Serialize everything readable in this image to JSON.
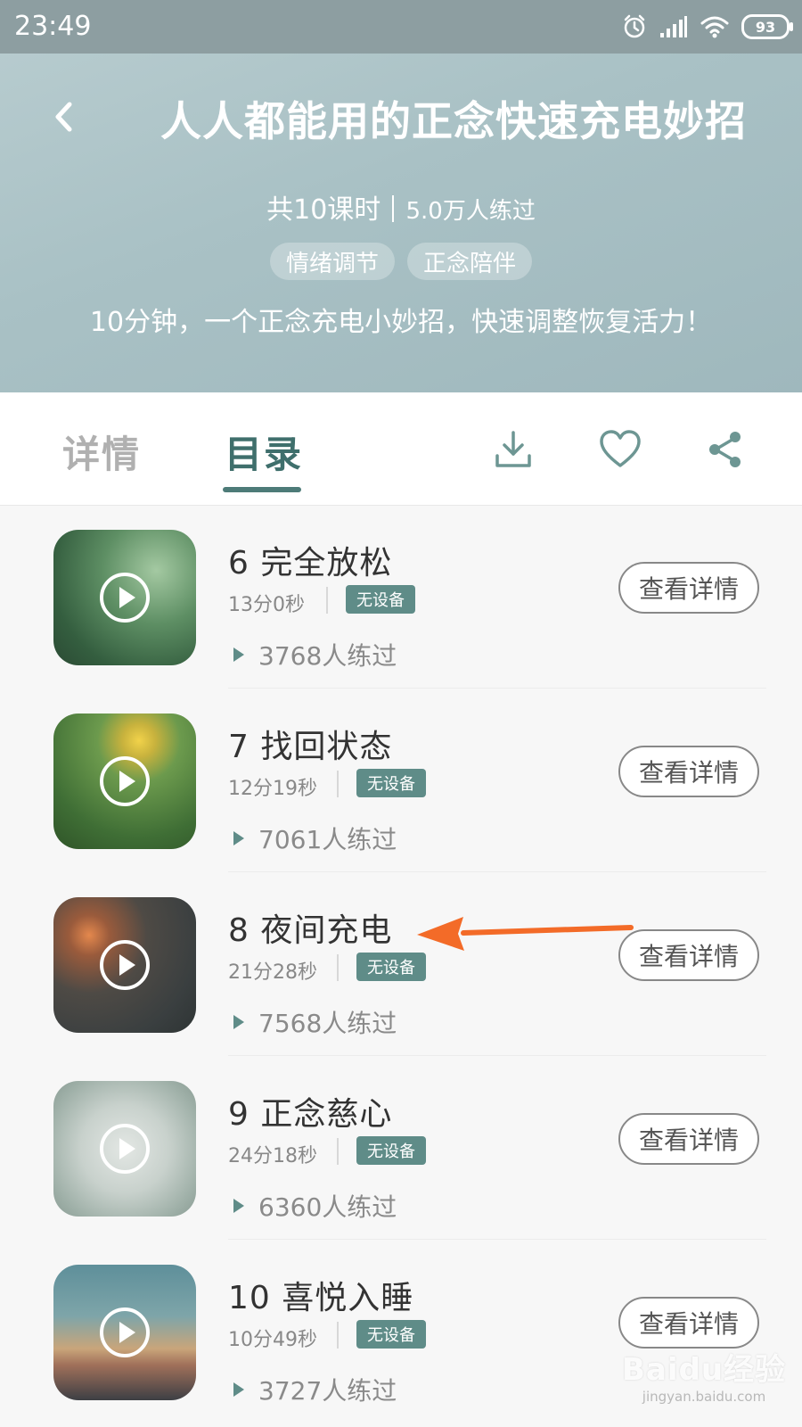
{
  "status_bar": {
    "time": "23:49",
    "battery": "93"
  },
  "header": {
    "title": "人人都能用的正念快速充电妙招",
    "lessons": "共10课时",
    "practiced": "5.0万人练过",
    "tags": [
      "情绪调节",
      "正念陪伴"
    ],
    "subtitle": "10分钟，一个正念充电小妙招，快速调整恢复活力！"
  },
  "tabs": {
    "detail": "详情",
    "catalog": "目录",
    "active": "catalog"
  },
  "items": [
    {
      "title": "6 完全放松",
      "duration": "13分0秒",
      "badge": "无设备",
      "count": "3768人练过",
      "button": "查看详情"
    },
    {
      "title": "7 找回状态",
      "duration": "12分19秒",
      "badge": "无设备",
      "count": "7061人练过",
      "button": "查看详情"
    },
    {
      "title": "8 夜间充电",
      "duration": "21分28秒",
      "badge": "无设备",
      "count": "7568人练过",
      "button": "查看详情"
    },
    {
      "title": "9 正念慈心",
      "duration": "24分18秒",
      "badge": "无设备",
      "count": "6360人练过",
      "button": "查看详情"
    },
    {
      "title": "10 喜悦入睡",
      "duration": "10分49秒",
      "badge": "无设备",
      "count": "3727人练过",
      "button": "查看详情"
    }
  ],
  "watermark": {
    "logo": "Baidu经验",
    "url": "jingyan.baidu.com"
  },
  "colors": {
    "accent": "#5f8c88",
    "annotation_arrow": "#f36b28"
  }
}
